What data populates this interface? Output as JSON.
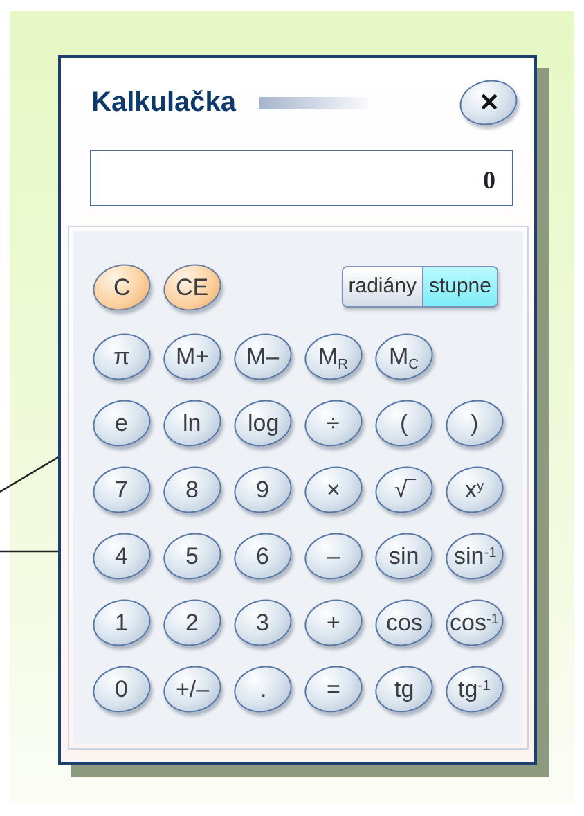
{
  "window": {
    "title": "Kalkulačka",
    "close": "✕"
  },
  "display": {
    "value": "0"
  },
  "clear_keys": [
    {
      "label": "C"
    },
    {
      "label": "CE"
    }
  ],
  "angle_modes": [
    {
      "label": "radiány",
      "selected": false
    },
    {
      "label": "stupne",
      "selected": true
    }
  ],
  "key_rows": [
    [
      "π",
      "M+",
      "M–",
      "M$_{R}$",
      "M$_{C}$"
    ],
    [
      "e",
      "ln",
      "log",
      "÷",
      "(",
      ")"
    ],
    [
      "7",
      "8",
      "9",
      "×",
      "√‾",
      "x$^{y}$"
    ],
    [
      "4",
      "5",
      "6",
      "–",
      "sin",
      "sin$^{-1}$"
    ],
    [
      "1",
      "2",
      "3",
      "+",
      "cos",
      "cos$^{-1}$"
    ],
    [
      "0",
      "+/–",
      ".",
      "=",
      "tg",
      "tg$^{-1}$"
    ]
  ]
}
